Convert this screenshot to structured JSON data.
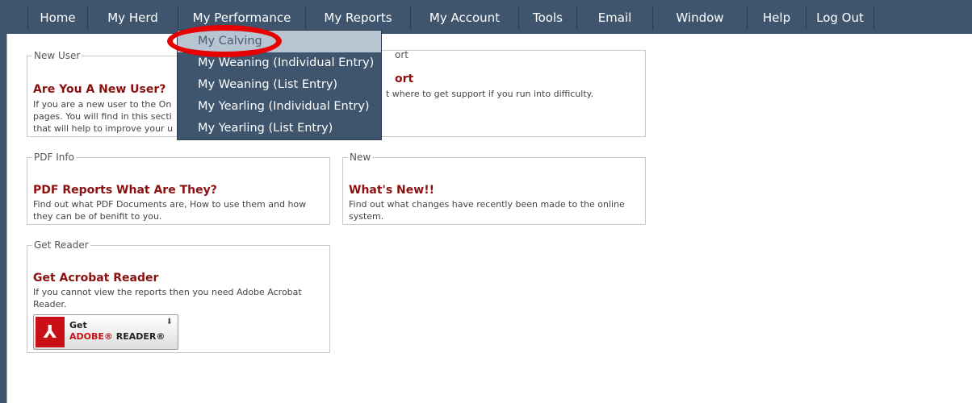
{
  "menu": {
    "items": [
      {
        "label": "Home"
      },
      {
        "label": "My Herd"
      },
      {
        "label": "My Performance"
      },
      {
        "label": "My Reports"
      },
      {
        "label": "My Account"
      },
      {
        "label": "Tools"
      },
      {
        "label": "Email"
      },
      {
        "label": "Window"
      },
      {
        "label": "Help"
      },
      {
        "label": "Log Out"
      }
    ]
  },
  "dropdown": {
    "items": [
      {
        "label": "My Calving",
        "selected": true
      },
      {
        "label": "My Weaning (Individual Entry)"
      },
      {
        "label": "My Weaning (List Entry)"
      },
      {
        "label": "My Yearling (Individual Entry)"
      },
      {
        "label": "My Yearling (List Entry)"
      }
    ]
  },
  "boxes": {
    "new_user": {
      "legend": "New User",
      "title": "Are You A New User?",
      "text_1": "If you are a new user to the On",
      "text_2": "pages. You will find in this secti",
      "text_3": "that will help to improve your u"
    },
    "support": {
      "legend_fragment": "ort",
      "title_fragment": "ort",
      "text_fragment": "t where to get support if you run into difficulty."
    },
    "pdf_info": {
      "legend": "PDF Info",
      "title": "PDF Reports What Are They?",
      "text_1": "Find out what PDF Documents are, How to use them and how",
      "text_2": "they can be of benifit to you."
    },
    "new": {
      "legend": "New",
      "title": "What's New!!",
      "text_1": "Find out what changes have recently been made to the online",
      "text_2": "system."
    },
    "get_reader": {
      "legend": "Get Reader",
      "title": "Get Acrobat Reader",
      "text_1": "If you cannot view the reports then you need Adobe Acrobat",
      "text_2": "Reader.",
      "button": {
        "get": "Get",
        "adobe": "ADOBE®",
        "reader": "READER®"
      }
    }
  },
  "colors": {
    "menubar": "#3e556d",
    "title": "#8b1010",
    "selected_item": "#b7c5d3",
    "highlight": "#e60000"
  }
}
